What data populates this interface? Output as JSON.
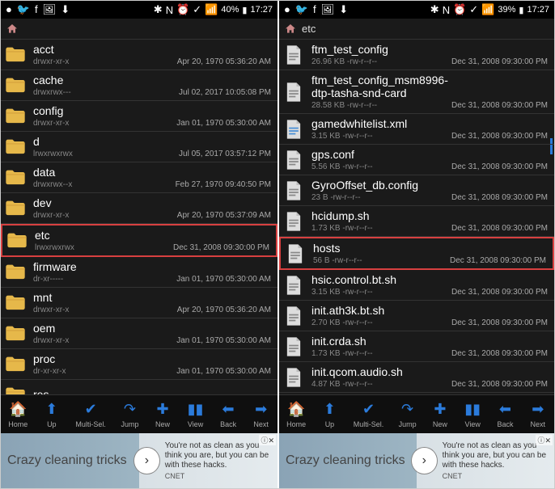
{
  "statusbar": {
    "left_icons": [
      "●",
      "🐦",
      "f",
      "🖼",
      "⬇"
    ],
    "right_icons": [
      "✱",
      "N",
      "⏰",
      "✓",
      "📶"
    ],
    "battery_left": "40%",
    "battery_right": "39%",
    "time": "17:27"
  },
  "left": {
    "path": "",
    "files": [
      {
        "name": "acct",
        "meta": "drwxr-xr-x",
        "date": "Apr 20, 1970 05:36:20 AM",
        "type": "folder",
        "hl": false
      },
      {
        "name": "cache",
        "meta": "drwxrwx---",
        "date": "Jul 02, 2017 10:05:08 PM",
        "type": "folder",
        "hl": false
      },
      {
        "name": "config",
        "meta": "drwxr-xr-x",
        "date": "Jan 01, 1970 05:30:00 AM",
        "type": "folder",
        "hl": false
      },
      {
        "name": "d",
        "meta": "lrwxrwxrwx",
        "date": "Jul 05, 2017 03:57:12 PM",
        "type": "folder",
        "hl": false
      },
      {
        "name": "data",
        "meta": "drwxrwx--x",
        "date": "Feb 27, 1970 09:40:50 PM",
        "type": "folder",
        "hl": false
      },
      {
        "name": "dev",
        "meta": "drwxr-xr-x",
        "date": "Apr 20, 1970 05:37:09 AM",
        "type": "folder",
        "hl": false
      },
      {
        "name": "etc",
        "meta": "lrwxrwxrwx",
        "date": "Dec 31, 2008 09:30:00 PM",
        "type": "folder",
        "hl": true
      },
      {
        "name": "firmware",
        "meta": "dr-xr-----",
        "date": "Jan 01, 1970 05:30:00 AM",
        "type": "folder",
        "hl": false
      },
      {
        "name": "mnt",
        "meta": "drwxr-xr-x",
        "date": "Apr 20, 1970 05:36:20 AM",
        "type": "folder",
        "hl": false
      },
      {
        "name": "oem",
        "meta": "drwxr-xr-x",
        "date": "Jan 01, 1970 05:30:00 AM",
        "type": "folder",
        "hl": false
      },
      {
        "name": "proc",
        "meta": "dr-xr-xr-x",
        "date": "Jan 01, 1970 05:30:00 AM",
        "type": "folder",
        "hl": false
      },
      {
        "name": "res",
        "meta": "",
        "date": "",
        "type": "folder",
        "hl": false
      }
    ]
  },
  "right": {
    "path": "etc",
    "files": [
      {
        "name": "ftm_test_config",
        "meta": "26.96 KB -rw-r--r--",
        "date": "Dec 31, 2008 09:30:00 PM",
        "type": "file",
        "hl": false
      },
      {
        "name": "ftm_test_config_msm8996-dtp-tasha-snd-card",
        "meta": "28.58 KB -rw-r--r--",
        "date": "Dec 31, 2008 09:30:00 PM",
        "type": "file",
        "hl": false
      },
      {
        "name": "gamedwhitelist.xml",
        "meta": "3.15 KB -rw-r--r--",
        "date": "Dec 31, 2008 09:30:00 PM",
        "type": "xml",
        "hl": false
      },
      {
        "name": "gps.conf",
        "meta": "5.56 KB -rw-r--r--",
        "date": "Dec 31, 2008 09:30:00 PM",
        "type": "file",
        "hl": false
      },
      {
        "name": "GyroOffset_db.config",
        "meta": "23 B -rw-r--r--",
        "date": "Dec 31, 2008 09:30:00 PM",
        "type": "file",
        "hl": false
      },
      {
        "name": "hcidump.sh",
        "meta": "1.73 KB -rw-r--r--",
        "date": "Dec 31, 2008 09:30:00 PM",
        "type": "file",
        "hl": false
      },
      {
        "name": "hosts",
        "meta": "56 B -rw-r--r--",
        "date": "Dec 31, 2008 09:30:00 PM",
        "type": "file",
        "hl": true
      },
      {
        "name": "hsic.control.bt.sh",
        "meta": "3.15 KB -rw-r--r--",
        "date": "Dec 31, 2008 09:30:00 PM",
        "type": "file",
        "hl": false
      },
      {
        "name": "init.ath3k.bt.sh",
        "meta": "2.70 KB -rw-r--r--",
        "date": "Dec 31, 2008 09:30:00 PM",
        "type": "file",
        "hl": false
      },
      {
        "name": "init.crda.sh",
        "meta": "1.73 KB -rw-r--r--",
        "date": "Dec 31, 2008 09:30:00 PM",
        "type": "file",
        "hl": false
      },
      {
        "name": "init.qcom.audio.sh",
        "meta": "4.87 KB -rw-r--r--",
        "date": "Dec 31, 2008 09:30:00 PM",
        "type": "file",
        "hl": false
      }
    ]
  },
  "toolbar": [
    {
      "icon": "🏠",
      "label": "Home"
    },
    {
      "icon": "⬆",
      "label": "Up"
    },
    {
      "icon": "✔",
      "label": "Multi-Sel."
    },
    {
      "icon": "↷",
      "label": "Jump"
    },
    {
      "icon": "✚",
      "label": "New"
    },
    {
      "icon": "▮▮",
      "label": "View"
    },
    {
      "icon": "⬅",
      "label": "Back"
    },
    {
      "icon": "➡",
      "label": "Next"
    }
  ],
  "ad": {
    "headline": "Crazy cleaning tricks",
    "body": "You're not as clean as you think you are, but you can be with these hacks.",
    "source": "CNET",
    "close": "✕"
  }
}
